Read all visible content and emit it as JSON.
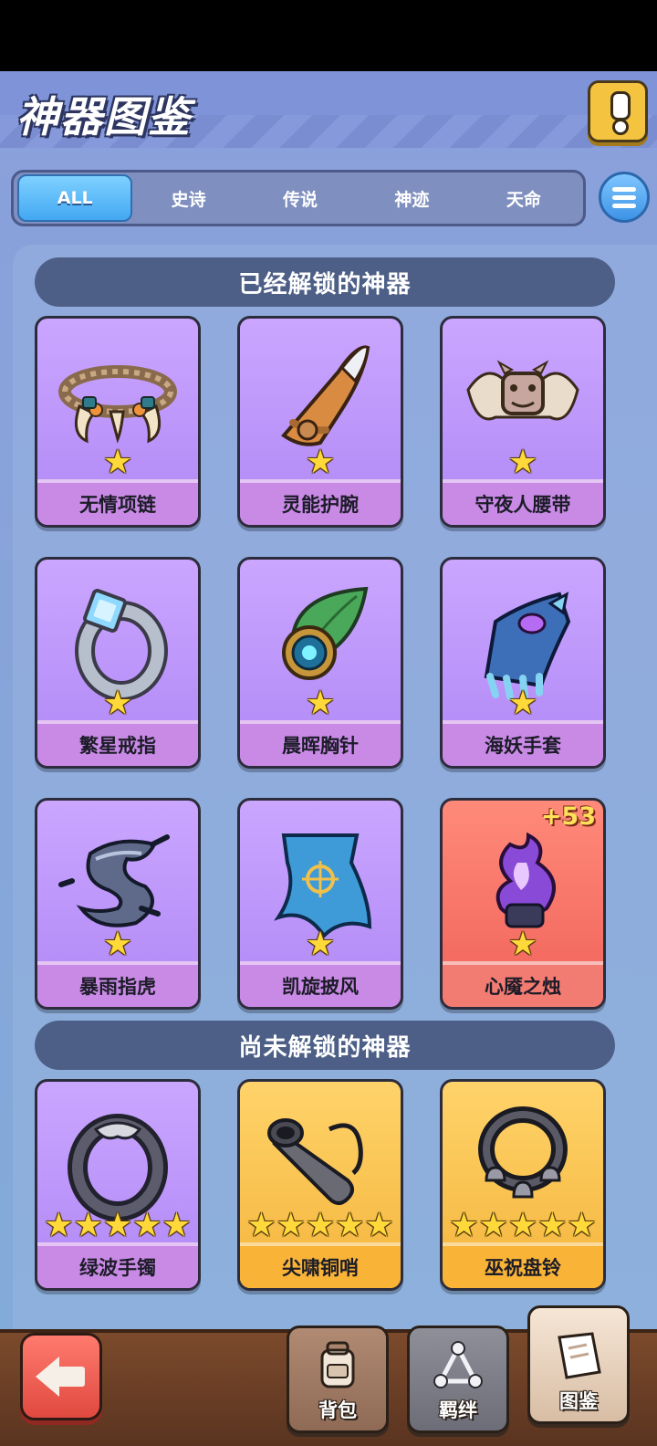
{
  "header": {
    "title": "神器图鉴"
  },
  "tabs": [
    "ALL",
    "史诗",
    "传说",
    "神迹",
    "天命"
  ],
  "sections": {
    "unlocked_title": "已经解锁的神器",
    "locked_title": "尚未解锁的神器"
  },
  "unlocked": [
    {
      "name": "无情项链",
      "stars": 1,
      "rarity": "purple",
      "icon": "necklace-icon"
    },
    {
      "name": "灵能护腕",
      "stars": 1,
      "rarity": "purple",
      "icon": "bracer-icon"
    },
    {
      "name": "守夜人腰带",
      "stars": 1,
      "rarity": "purple",
      "icon": "belt-icon"
    },
    {
      "name": "繁星戒指",
      "stars": 1,
      "rarity": "purple",
      "icon": "ring-icon"
    },
    {
      "name": "晨晖胸针",
      "stars": 1,
      "rarity": "purple",
      "icon": "brooch-icon"
    },
    {
      "name": "海妖手套",
      "stars": 1,
      "rarity": "purple",
      "icon": "glove-icon"
    },
    {
      "name": "暴雨指虎",
      "stars": 1,
      "rarity": "purple",
      "icon": "knuckle-icon"
    },
    {
      "name": "凯旋披风",
      "stars": 1,
      "rarity": "purple",
      "icon": "cape-icon"
    },
    {
      "name": "心魇之烛",
      "stars": 1,
      "rarity": "red",
      "icon": "candle-icon",
      "bonus": "+53"
    }
  ],
  "locked": [
    {
      "name": "绿波手镯",
      "stars": 5,
      "rarity": "purple",
      "icon": "bracelet-icon"
    },
    {
      "name": "尖啸铜哨",
      "stars": 5,
      "rarity": "gold",
      "icon": "whistle-icon"
    },
    {
      "name": "巫祝盘铃",
      "stars": 5,
      "rarity": "gold",
      "icon": "bell-icon"
    }
  ],
  "nav": {
    "bag": "背包",
    "bond": "羁绊",
    "codex": "图鉴"
  },
  "colors": {
    "purple_card": "#b088f5",
    "red_card": "#f0625a",
    "gold_card": "#f4b53c",
    "active_tab": "#43a8f2"
  }
}
